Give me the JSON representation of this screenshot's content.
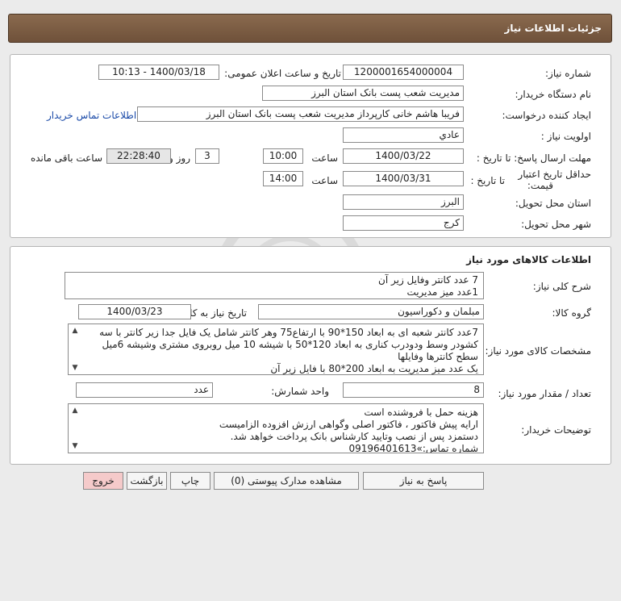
{
  "header": {
    "title": "جزئیات اطلاعات نیاز"
  },
  "info": {
    "need_number_label": "شماره نیاز:",
    "need_number": "1200001654000004",
    "announce_label": "تاریخ و ساعت اعلان عمومی:",
    "announce_value": "1400/03/18 - 10:13",
    "buyer_label": "نام دستگاه خریدار:",
    "buyer_value": "مدیریت شعب پست بانک استان البرز",
    "creator_label": "ایجاد کننده درخواست:",
    "creator_value": "فریبا هاشم خانی کارپرداز مدیریت شعب پست بانک استان البرز",
    "contact_link": "اطلاعات تماس خریدار",
    "priority_label": "اولویت نیاز :",
    "priority_value": "عادي",
    "deadline_label": "مهلت ارسال پاسخ: تا تاریخ :",
    "deadline_date": "1400/03/22",
    "time_label": "ساعت",
    "deadline_time": "10:00",
    "days_value": "3",
    "days_label": "روز و",
    "remaining_time": "22:28:40",
    "remaining_label": "ساعت باقی مانده",
    "validity_label_1": "حداقل تاریخ اعتبار",
    "validity_label_2": "قیمت:",
    "validity_to_label": "تا تاریخ :",
    "validity_date": "1400/03/31",
    "validity_time": "14:00",
    "province_label": "استان محل تحویل:",
    "province_value": "البرز",
    "city_label": "شهر محل تحویل:",
    "city_value": "کرج"
  },
  "goods": {
    "section_title": "اطلاعات کالاهای مورد نیاز",
    "summary_label": "شرح کلی نیاز:",
    "summary_lines": [
      "7 عدد کانتر وفایل زیر آن",
      "1عدد میز مدیریت"
    ],
    "group_label": "گروه کالا:",
    "group_value": "مبلمان و دکوراسیون",
    "need_date_label": "تاریخ نیاز به کالا:",
    "need_date_value": "1400/03/23",
    "spec_label": "مشخصات کالای مورد نیاز:",
    "spec_lines": [
      "7عدد کانتر شعبه ای به ابعاد 150*90 با ارتفاع75 وهر کانتر شامل یک فایل جدا زیر کانتر با سه",
      "کشودر وسط ودودرب کناری به ابعاد 120*50 با شیشه 10 میل روبروی مشتری وشیشه 6میل",
      "سطح کانترها وفایلها",
      "یک عدد میز مدیریت به ابعاد 200*80 با فایل زیر آن"
    ],
    "qty_label": "تعداد / مقدار مورد نیاز:",
    "qty_value": "8",
    "unit_label": "واحد شمارش:",
    "unit_value": "عدد",
    "buyer_notes_label": "توضیحات خریدار:",
    "notes_lines": [
      "هزینه حمل با فروشنده است",
      "ارایه پیش فاکتور ، فاکتور اصلی وگواهی ارزش افزوده الزامیست",
      "دستمزد پس از نصب وتایید کارشناس بانک پرداخت خواهد شد.",
      "شماره تماس:»09196401613"
    ]
  },
  "buttons": {
    "reply": "پاسخ به نیاز",
    "attachments": "مشاهده مدارک پیوستی (0)",
    "print": "چاپ",
    "back": "بازگشت",
    "exit": "خروج"
  },
  "icons": {
    "scroll_up": "▲",
    "scroll_down": "▼"
  },
  "colors": {
    "header": "#7b5c42",
    "link": "#1a4aa8",
    "exit_button": "#f5caca"
  }
}
